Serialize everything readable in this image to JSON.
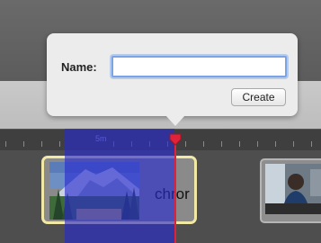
{
  "popover": {
    "name_label": "Name:",
    "name_value": "",
    "create_label": "Create"
  },
  "timeline": {
    "ruler_label": "5m"
  },
  "clip": {
    "title": "chror"
  },
  "colors": {
    "selection": "#2828d2",
    "playhead": "#e0223a",
    "field_focus": "#7aa4e6",
    "clip_border": "#f2e8a6"
  }
}
